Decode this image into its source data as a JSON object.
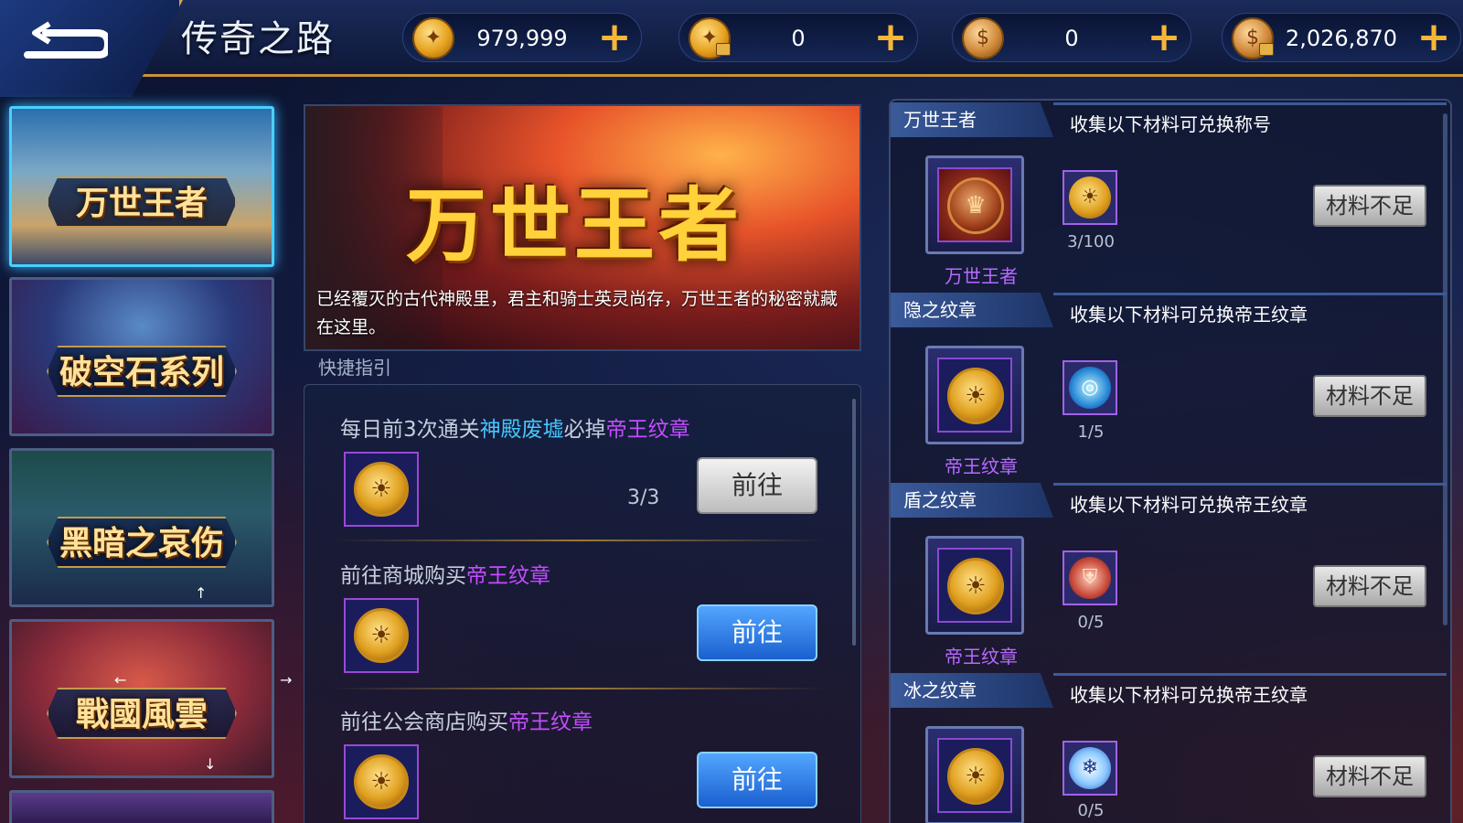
{
  "header": {
    "title": "传奇之路",
    "currencies": [
      {
        "icon": "gold-coin-icon",
        "amount": "979,999"
      },
      {
        "icon": "locked-gold-coin-icon",
        "amount": "0"
      },
      {
        "icon": "bronze-coin-icon",
        "amount": "0"
      },
      {
        "icon": "locked-bronze-coin-icon",
        "amount": "2,026,870"
      }
    ],
    "plus_glyph": "+"
  },
  "sidebar": {
    "items": [
      {
        "label": "万世王者",
        "active": true
      },
      {
        "label": "破空石系列",
        "active": false
      },
      {
        "label": "黑暗之哀伤",
        "active": false
      },
      {
        "label": "戰國風雲",
        "active": false
      }
    ]
  },
  "banner": {
    "title": "万世王者",
    "description": "已经覆灭的古代神殿里，君主和骑士英灵尚存，万世王者的秘密就藏在这里。"
  },
  "guide": {
    "label": "快捷指引",
    "items": [
      {
        "prefix": "每日前3次通关",
        "highlight1": "神殿废墟",
        "middle": "必掉",
        "highlight2": "帝王纹章",
        "progress": "3/3",
        "button": "前往",
        "button_style": "gray"
      },
      {
        "prefix": "前往商城购买",
        "highlight2": "帝王纹章",
        "button": "前往",
        "button_style": "blue"
      },
      {
        "prefix": "前往公会商店购买",
        "highlight2": "帝王纹章",
        "button": "前往",
        "button_style": "blue"
      }
    ]
  },
  "exchange": {
    "sections": [
      {
        "tab": "万世王者",
        "desc": "收集以下材料可兑换称号",
        "reward_label": "万世王者",
        "reward_icon": "king-helmet-icon",
        "material_icon": "emperor-medal-icon",
        "count": "3/100",
        "button": "材料不足"
      },
      {
        "tab": "隐之纹章",
        "desc": "收集以下材料可兑换帝王纹章",
        "reward_label": "帝王纹章",
        "reward_icon": "emperor-medal-icon",
        "material_icon": "soul-whirlwind-icon",
        "count": "1/5",
        "button": "材料不足"
      },
      {
        "tab": "盾之纹章",
        "desc": "收集以下材料可兑换帝王纹章",
        "reward_label": "帝王纹章",
        "reward_icon": "emperor-medal-icon",
        "material_icon": "soul-shield-icon",
        "count": "0/5",
        "button": "材料不足"
      },
      {
        "tab": "冰之纹章",
        "desc": "收集以下材料可兑换帝王纹章",
        "reward_label": "",
        "reward_icon": "emperor-medal-icon",
        "material_icon": "soul-ice-icon",
        "count": "0/5",
        "button": "材料不足"
      }
    ]
  },
  "colors": {
    "accent_gold": "#f7b637",
    "highlight_cyan": "#46c6ff",
    "highlight_purple": "#c44cff",
    "active_border": "#49d0ff"
  }
}
